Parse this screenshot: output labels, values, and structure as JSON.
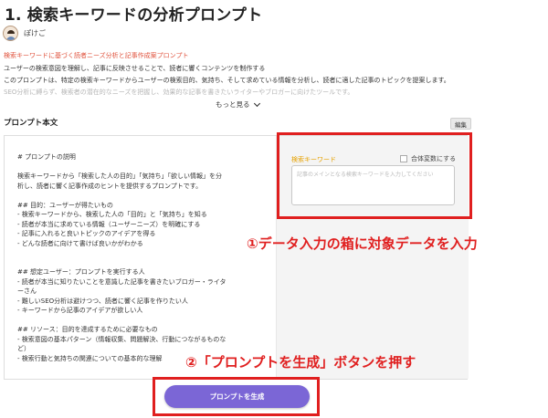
{
  "page": {
    "title": "1. 検索キーワードの分析プロンプト",
    "author": "ぽけご",
    "subtitle": "検索キーワードに基づく読者ニーズ分析と記事作成案プロンプト",
    "description_lines": [
      "ユーザーの検索意図を理解し、記事に反映させることで、読者に響くコンテンツを制作する",
      "このプロンプトは、特定の検索キーワードからユーザーの検索目的、気持ち、そして求めている情報を分析し、読者に適した記事のトピックを提案します。",
      "SEO分析に縛らず、検索者の潜在的なニーズを把握し、効果的な記事を書きたいライターやブロガーに向けたツールです。"
    ],
    "more_label": "もっと見る"
  },
  "prompt_section": {
    "title": "プロンプト本文",
    "edit_label": "編集",
    "lines": [
      "# プロンプトの説明",
      "",
      "検索キーワードから「検索した人の目的」「気持ち」「欲しい情報」を分",
      "析し、読者に響く記事作成のヒントを提供するプロンプトです。",
      "",
      "## 目的：ユーザーが得たいもの",
      "- 検索キーワードから、検索した人の「目的」と「気持ち」を知る",
      "- 読者が本当に求めている情報（ユーザーニーズ）を明確にする",
      "- 記事に入れると良いトピックのアイデアを得る",
      "- どんな読者に向けて書けば良いかがわかる",
      "",
      "",
      "## 想定ユーザー：プロンプトを実行する人",
      "- 読者が本当に知りたいことを意識した記事を書きたいブロガー・ライタ",
      "ーさん",
      "- 難しいSEO分析は避けつつ、読者に響く記事を作りたい人",
      "- キーワードから記事のアイデアが欲しい人",
      "",
      "## リソース：目的を達成するために必要なもの",
      "- 検索意図の基本パターン（情報収集、問題解決、行動につながるものな",
      "ど）",
      "- 検索行動と気持ちの関連についての基本的な理解"
    ]
  },
  "input_panel": {
    "label": "検索キーワード",
    "checkbox_label": "合体変数にする",
    "placeholder": "記事のメインとなる検索キーワードを入力してください"
  },
  "annotations": {
    "step1": "①データ入力の箱に対象データを入力",
    "step2": "②「プロンプトを生成」ボタンを押す"
  },
  "generate_button": {
    "label": "プロンプトを生成"
  },
  "colors": {
    "accent_red": "#e01f1f",
    "button_purple": "#7b66d6",
    "label_orange": "#e6a100",
    "subtitle_red": "#e0523c"
  }
}
